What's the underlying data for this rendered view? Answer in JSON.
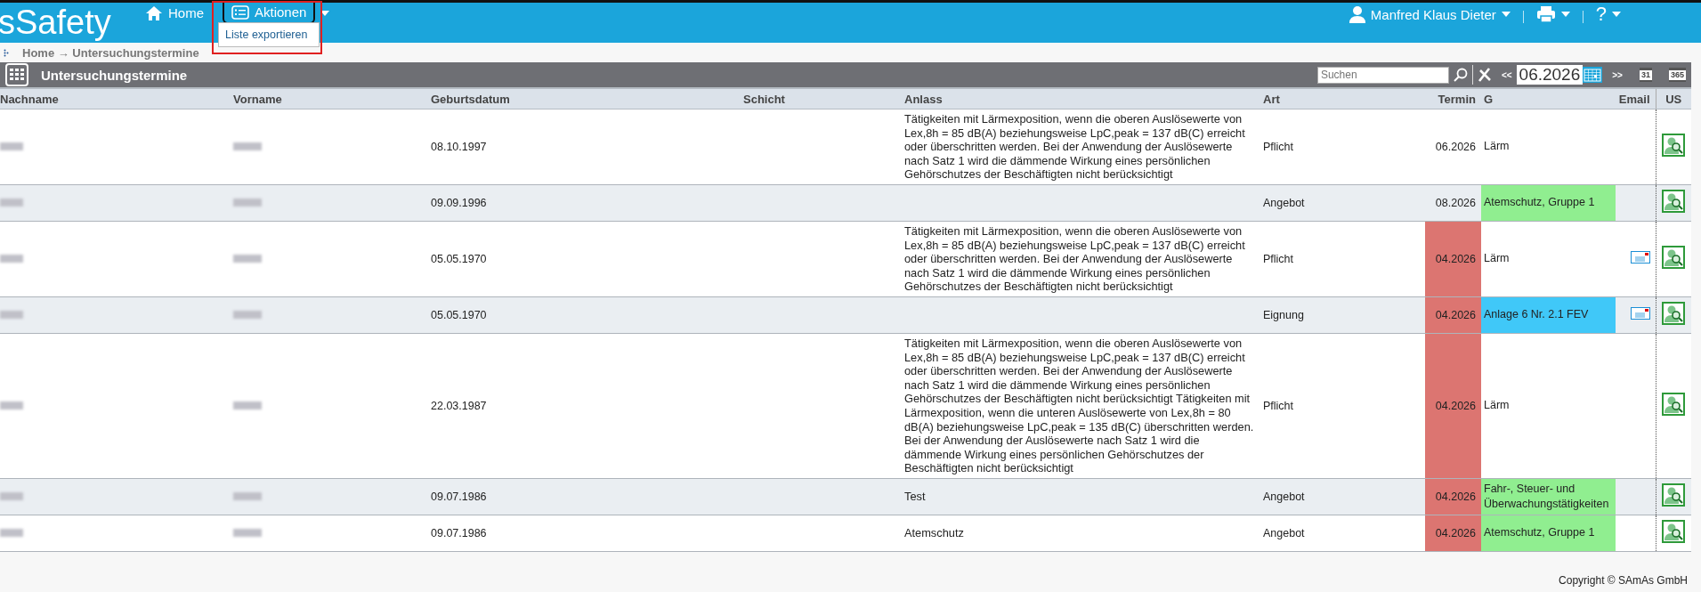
{
  "app": {
    "logo": "sSafety",
    "nav": [
      {
        "label": "Home",
        "kind": "home"
      },
      {
        "label": "Aktionen",
        "kind": "menu"
      }
    ],
    "menu": {
      "expanded": true,
      "items": [
        "Liste exportieren"
      ]
    },
    "user": "Manfred Klaus Dieter",
    "help": "?"
  },
  "breadcrumb": "Home → Untersuchungstermine",
  "panel": {
    "title": "Untersuchungstermine",
    "search": {
      "placeholder": "Suchen"
    },
    "prev": "<<",
    "month": "06.2026",
    "next": ">>",
    "day_view": "31",
    "year_view": "365"
  },
  "table": {
    "columns": [
      "Nachname",
      "Vorname",
      "Geburtsdatum",
      "Schicht",
      "Anlass",
      "Art",
      "Termin",
      "G",
      "Email",
      "US"
    ],
    "rows": [
      {
        "geburtsdatum": "08.10.1997",
        "anlass": "Tätigkeiten mit Lärmexposition, wenn die oberen Auslösewerte von Lex,8h = 85 dB(A) beziehungsweise LpC,peak = 137 dB(C) erreicht oder überschritten werden. Bei der Anwendung der Auslösewerte nach Satz 1 wird die dämmende Wirkung eines persönlichen Gehörschutzes der Beschäftigten nicht berücksichtigt",
        "art": "Pflicht",
        "termin": "06.2026",
        "overdue": false,
        "g": "Lärm",
        "email": false
      },
      {
        "geburtsdatum": "09.09.1996",
        "anlass": "",
        "art": "Angebot",
        "termin": "08.2026",
        "overdue": false,
        "g": "Atemschutz, Gruppe 1",
        "color": "#90ee90",
        "email": false
      },
      {
        "geburtsdatum": "05.05.1970",
        "anlass": "Tätigkeiten mit Lärmexposition, wenn die oberen Auslösewerte von Lex,8h = 85 dB(A) beziehungsweise LpC,peak = 137 dB(C) erreicht oder überschritten werden. Bei der Anwendung der Auslösewerte nach Satz 1 wird die dämmende Wirkung eines persönlichen Gehörschutzes der Beschäftigten nicht berücksichtigt",
        "art": "Pflicht",
        "termin": "04.2026",
        "overdue": true,
        "g": "Lärm",
        "email": true
      },
      {
        "geburtsdatum": "05.05.1970",
        "anlass": "",
        "art": "Eignung",
        "termin": "04.2026",
        "overdue": true,
        "g": "Anlage 6 Nr. 2.1 FEV",
        "color": "#40c8f8",
        "email": true
      },
      {
        "geburtsdatum": "22.03.1987",
        "anlass": "Tätigkeiten mit Lärmexposition, wenn die oberen Auslösewerte von Lex,8h = 85 dB(A) beziehungsweise LpC,peak = 137 dB(C) erreicht oder überschritten werden. Bei der Anwendung der Auslösewerte nach Satz 1 wird die dämmende Wirkung eines persönlichen Gehörschutzes der Beschäftigten nicht berücksichtigt Tätigkeiten mit Lärmexposition, wenn die unteren Auslösewerte von Lex,8h = 80 dB(A) beziehungsweise LpC,peak = 135 dB(C) überschritten werden. Bei der Anwendung der Auslösewerte nach Satz 1 wird die dämmende Wirkung eines persönlichen Gehörschutzes der Beschäftigten nicht berücksichtigt",
        "art": "Pflicht",
        "termin": "04.2026",
        "overdue": true,
        "g": "Lärm",
        "email": false
      },
      {
        "geburtsdatum": "09.07.1986",
        "anlass": "Test",
        "art": "Angebot",
        "termin": "04.2026",
        "overdue": true,
        "g": "Fahr-, Steuer- und Überwachungstätigkeiten",
        "color": "#90ee90",
        "email": false
      },
      {
        "geburtsdatum": "09.07.1986",
        "anlass": "Atemschutz",
        "art": "Angebot",
        "termin": "04.2026",
        "overdue": true,
        "g": "Atemschutz, Gruppe 1",
        "color": "#90ee90",
        "email": false
      }
    ]
  },
  "footer": "Copyright © SAmAs GmbH"
}
